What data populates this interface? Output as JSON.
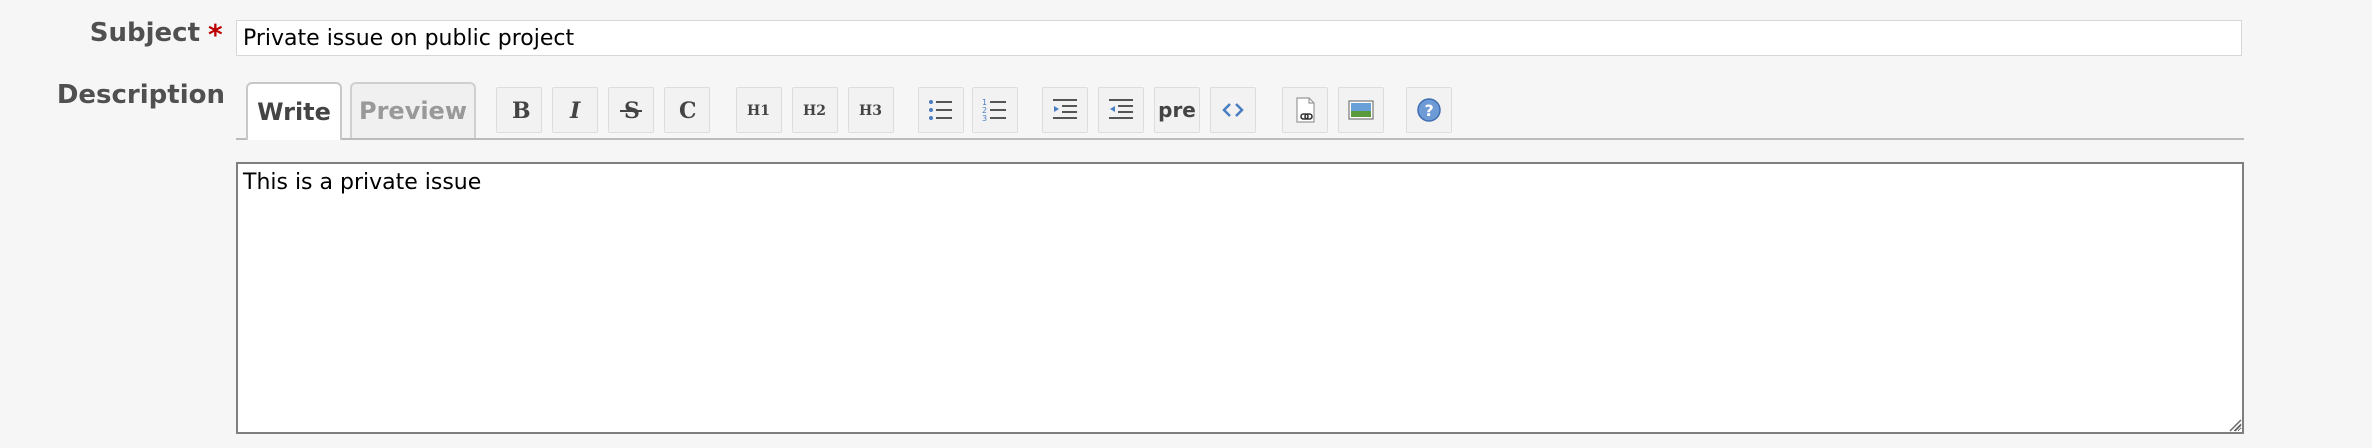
{
  "subject": {
    "label": "Subject",
    "required_mark": "*",
    "value": "Private issue on public project"
  },
  "description": {
    "label": "Description",
    "value": "This is a private issue"
  },
  "tabs": {
    "write": "Write",
    "preview": "Preview"
  },
  "toolbar": [
    {
      "name": "bold-button",
      "icon": "bold-icon"
    },
    {
      "name": "italic-button",
      "icon": "italic-icon"
    },
    {
      "name": "strikethrough-button",
      "icon": "strikethrough-icon"
    },
    {
      "name": "code-button",
      "icon": "code-c-icon"
    },
    {
      "name": "heading1-button",
      "icon": "h1-icon"
    },
    {
      "name": "heading2-button",
      "icon": "h2-icon"
    },
    {
      "name": "heading3-button",
      "icon": "h3-icon"
    },
    {
      "name": "bullet-list-button",
      "icon": "bullet-list-icon"
    },
    {
      "name": "numbered-list-button",
      "icon": "numbered-list-icon"
    },
    {
      "name": "indent-button",
      "icon": "indent-icon"
    },
    {
      "name": "outdent-button",
      "icon": "outdent-icon"
    },
    {
      "name": "preformatted-button",
      "icon": "pre-icon"
    },
    {
      "name": "inline-code-button",
      "icon": "angle-brackets-icon"
    },
    {
      "name": "link-button",
      "icon": "link-page-icon"
    },
    {
      "name": "image-button",
      "icon": "image-icon"
    },
    {
      "name": "help-button",
      "icon": "help-icon"
    }
  ],
  "toolbar_text": {
    "pre": "pre"
  },
  "colors": {
    "required": "#bb0000",
    "label": "#505050",
    "link_blue": "#4a7ec3"
  }
}
